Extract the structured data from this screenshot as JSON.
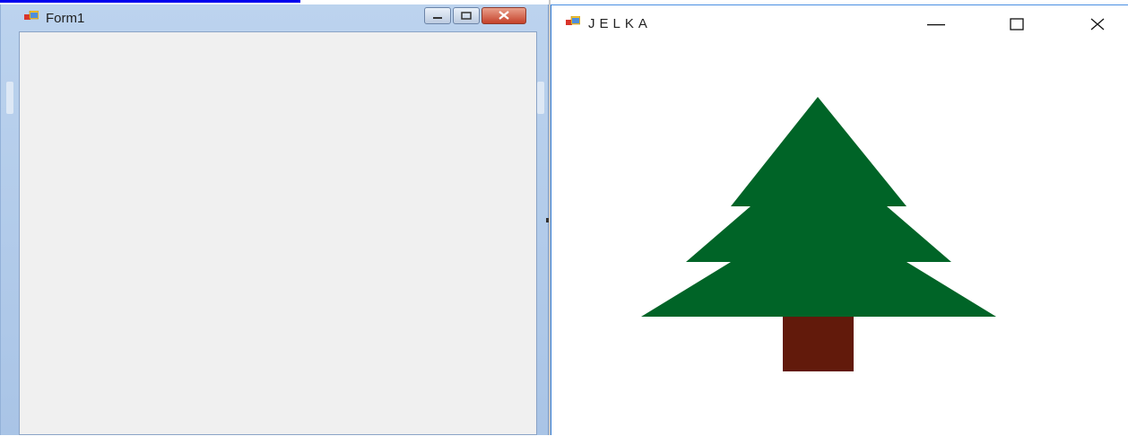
{
  "left_window": {
    "title": "Form1"
  },
  "right_window": {
    "title": "JELKA"
  },
  "colors": {
    "tree_green": "#006427",
    "trunk_brown": "#621a0b",
    "client_gray": "#f0f0f0",
    "title_blue": "#bcd3ee"
  },
  "icons": [
    "app-icon",
    "minimize-icon",
    "maximize-icon",
    "close-icon"
  ]
}
